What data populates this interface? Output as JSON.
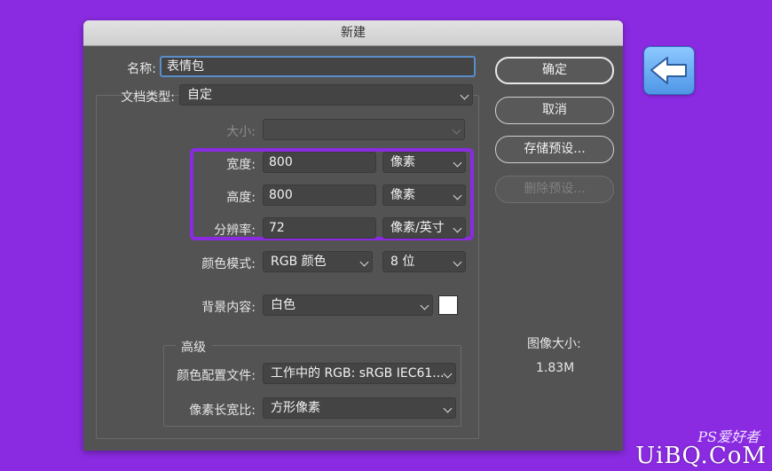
{
  "dialog": {
    "title": "新建"
  },
  "form": {
    "name_label": "名称:",
    "name_value": "表情包",
    "doc_type_label": "文档类型:",
    "doc_type_value": "自定",
    "size_label": "大小:",
    "size_value": "",
    "width_label": "宽度:",
    "width_value": "800",
    "width_unit": "像素",
    "height_label": "高度:",
    "height_value": "800",
    "height_unit": "像素",
    "resolution_label": "分辨率:",
    "resolution_value": "72",
    "resolution_unit": "像素/英寸",
    "color_mode_label": "颜色模式:",
    "color_mode_value": "RGB 颜色",
    "bit_depth_value": "8 位",
    "background_label": "背景内容:",
    "background_value": "白色",
    "background_swatch_color": "#ffffff"
  },
  "advanced": {
    "title": "高级",
    "color_profile_label": "颜色配置文件:",
    "color_profile_value": "工作中的 RGB: sRGB IEC61...",
    "pixel_aspect_label": "像素长宽比:",
    "pixel_aspect_value": "方形像素"
  },
  "buttons": {
    "ok": "确定",
    "cancel": "取消",
    "save_preset": "存储预设...",
    "delete_preset": "删除预设..."
  },
  "image_size": {
    "label": "图像大小:",
    "value": "1.83M"
  },
  "watermark": {
    "site": "UiBQ.CoM",
    "brand": "PS爱好者"
  },
  "colors": {
    "background": "#8a2be2",
    "highlight": "#8a2be2",
    "dialog": "#535353"
  }
}
